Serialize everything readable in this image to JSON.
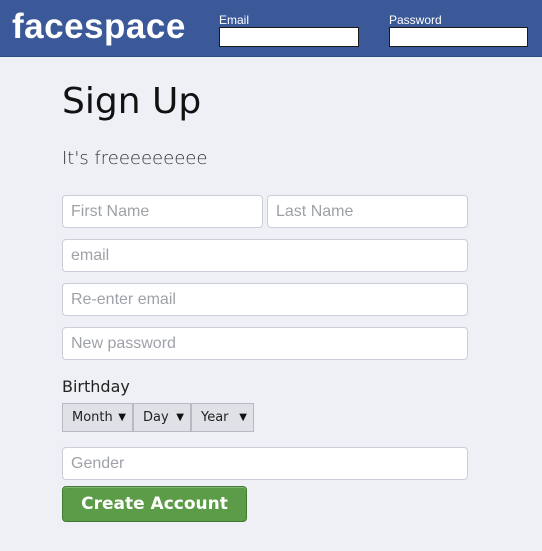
{
  "header": {
    "logo": "facespace",
    "email_label": "Email",
    "password_label": "Password",
    "email_value": "",
    "password_value": ""
  },
  "signup": {
    "title": "Sign Up",
    "subtitle": "It's freeeeeeeee",
    "first_name_placeholder": "First Name",
    "last_name_placeholder": "Last Name",
    "email_placeholder": "email",
    "reenter_email_placeholder": "Re-enter email",
    "password_placeholder": "New password",
    "birthday_label": "Birthday",
    "month_label": "Month",
    "day_label": "Day",
    "year_label": "Year",
    "gender_placeholder": "Gender",
    "create_button": "Create Account"
  },
  "colors": {
    "header_bg": "#3b5998",
    "page_bg": "#eef0f5",
    "button_green": "#5c9c48"
  }
}
